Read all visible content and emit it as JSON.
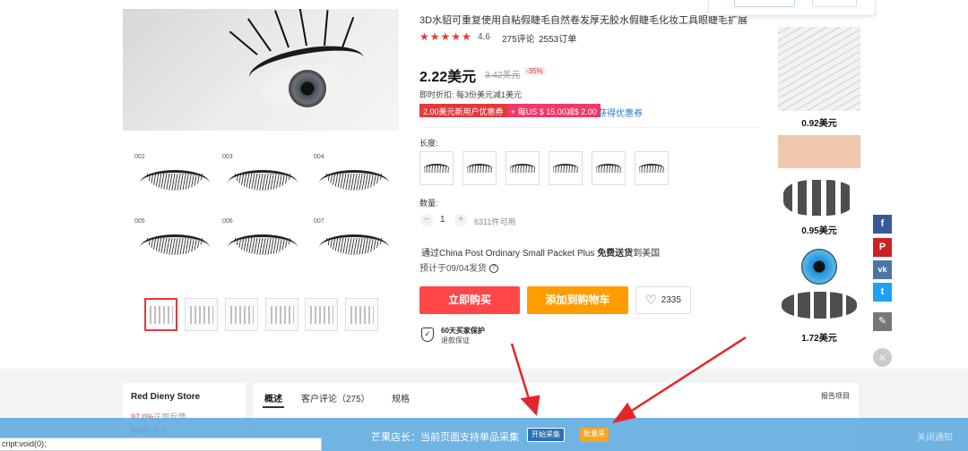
{
  "product": {
    "title": "3D水貂可重复使用自粘假睫毛自然卷发厚无胶水假睫毛化妆工具眼睫毛扩展",
    "stars": "★★★★★",
    "rating": "4.6",
    "review_count": "275评论",
    "orders": "2553订单",
    "price": "2.22美元",
    "old_price": "3.42美元",
    "discount": "-35%",
    "instant_discount": "即时折扣: 每3份美元减1美元",
    "coupons": [
      "2.00美元新用户优惠券",
      "+ 每US $ 15.00减$ 2.00"
    ],
    "get_coupon": "获得优惠券",
    "length_label": "长度:",
    "variant_count": 6,
    "quantity_label": "数量:",
    "qty_minus": "−",
    "qty_plus": "+",
    "quantity": "1",
    "available": "6311件可用",
    "shipping_prefix": "通过China Post Ordinary Small Packet Plus ",
    "shipping_free": "免费送货",
    "shipping_suffix": "到美国",
    "estimate": "预计于09/04发货",
    "help_icon": "?",
    "buy_now": "立即购买",
    "add_to_cart": "添加到购物车",
    "wishlist_count": "2335",
    "heart_icon": "♡",
    "protection_icon": "✓",
    "protection_title": "60天买家保护",
    "protection_sub": "退款保证"
  },
  "gallery": {
    "lash_numbers": [
      "002",
      "003",
      "004",
      "005",
      "006",
      "007"
    ],
    "thumbnail_count": 6,
    "selected_thumbnail": 0
  },
  "rail": {
    "prices": [
      "0.92美元",
      "0.95美元",
      "1.72美元"
    ]
  },
  "social": [
    {
      "icon": "f",
      "color": "#3b5998"
    },
    {
      "icon": "P",
      "color": "#cb2027"
    },
    {
      "icon": "vk",
      "color": "#4c75a3"
    },
    {
      "icon": "t",
      "color": "#1da1f2"
    },
    {
      "icon": "✎",
      "color": "#777777"
    }
  ],
  "close_icon": "×",
  "store": {
    "name": "Red Dieny Store",
    "feedback_value": "97.0%",
    "feedback_label": "正面反馈",
    "followers_value": "8848 ",
    "followers_label": "关注"
  },
  "tabs": {
    "overview": "概述",
    "reviews": "客户评论",
    "reviews_count": "（275）",
    "specs": "规格",
    "report": "报告项目"
  },
  "plugin_bar": {
    "text": "芒果店长：当前页面支持单品采集",
    "start_button": "开始采集",
    "second_button": "批量采",
    "close": "关闭通知"
  },
  "status_bar": "cript:void(0);"
}
